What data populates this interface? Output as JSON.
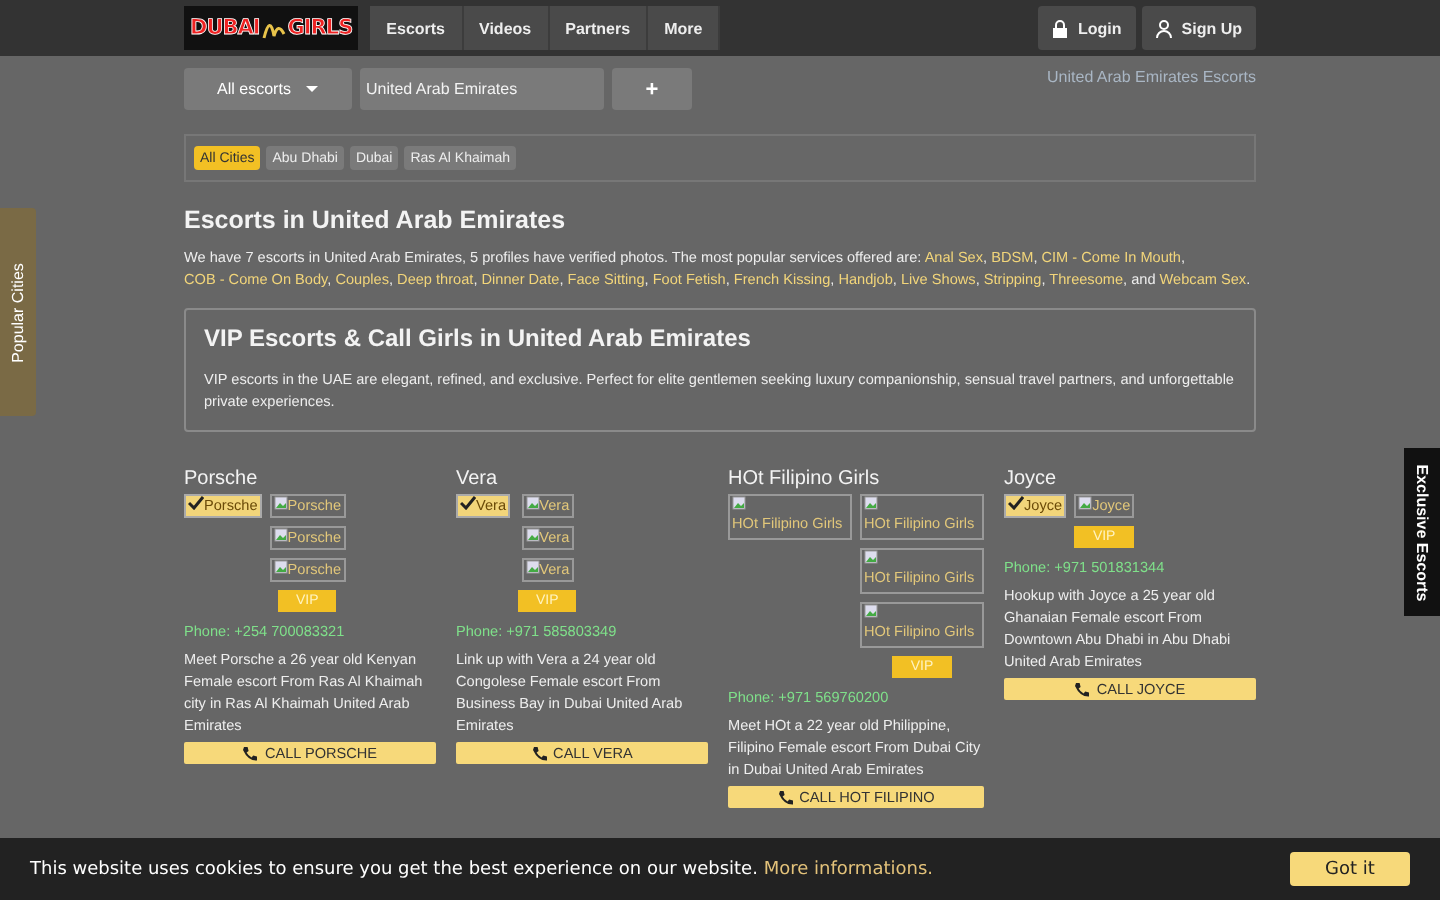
{
  "header": {
    "logo": [
      "DUBAI",
      "GIRLS"
    ],
    "nav": [
      "Escorts",
      "Videos",
      "Partners",
      "More"
    ],
    "login": "Login",
    "signup": "Sign Up"
  },
  "search": {
    "filter": "All escorts",
    "value": "United Arab Emirates",
    "add": "+",
    "faint_link": "United Arab Emirates Escorts"
  },
  "cities": [
    {
      "label": "All Cities",
      "selected": true
    },
    {
      "label": "Abu Dhabi",
      "selected": false
    },
    {
      "label": "Dubai",
      "selected": false
    },
    {
      "label": "Ras Al Khaimah",
      "selected": false
    }
  ],
  "side_tabs": {
    "left": "Popular Cities",
    "right": "Exclusive Escorts"
  },
  "heading": "Escorts in United Arab Emirates",
  "intro": {
    "text": "We have 7 escorts in United Arab Emirates, 5 profiles have verified photos. The most popular services offered are:",
    "links": [
      "Anal Sex",
      "BDSM",
      "CIM - Come In Mouth",
      "COB - Come On Body",
      "Couples",
      "Deep throat",
      "Dinner Date",
      "Face Sitting",
      "Foot Fetish",
      "French Kissing",
      "Handjob",
      "Live Shows",
      "Stripping",
      "Threesome"
    ],
    "last_link": "Webcam Sex",
    "joiner": "and",
    "separator": ",",
    "end": "."
  },
  "vip_box": {
    "title": "VIP Escorts & Call Girls in United Arab Emirates",
    "text": "VIP escorts in the UAE are elegant, refined, and exclusive. Perfect for elite gentlemen seeking luxury companionship, sensual travel partners, and unforgettable private experiences."
  },
  "profiles": [
    {
      "name": "Porsche",
      "images": [
        {
          "alt": "Porsche",
          "kind": "verified"
        },
        {
          "alt": "Porsche",
          "kind": "broken"
        },
        {
          "alt": "Porsche",
          "kind": "broken"
        },
        {
          "alt": "Porsche",
          "kind": "broken"
        }
      ],
      "badge": "VIP",
      "phone": "Phone: +254 700083321",
      "text": "Meet Porsche a 26 year old Kenyan Female escort From Ras Al Khaimah city in Ras Al Khaimah United Arab Emirates",
      "call": "CALL PORSCHE"
    },
    {
      "name": "Vera",
      "images": [
        {
          "alt": "Vera",
          "kind": "verified"
        },
        {
          "alt": "Vera",
          "kind": "broken"
        },
        {
          "alt": "Vera",
          "kind": "broken"
        },
        {
          "alt": "Vera",
          "kind": "broken"
        }
      ],
      "badge": "VIP",
      "phone": "Phone: +971 585803349",
      "text": "Link up with Vera a 24 year old Congolese Female escort From Business Bay in Dubai United Arab Emirates",
      "call": "CALL VERA"
    },
    {
      "name": "HOt Filipino Girls",
      "images": [
        {
          "alt": "HOt Filipino Girls",
          "kind": "broken"
        },
        {
          "alt": "HOt Filipino Girls",
          "kind": "broken"
        },
        {
          "alt": "HOt Filipino Girls",
          "kind": "broken"
        },
        {
          "alt": "HOt Filipino Girls",
          "kind": "broken"
        }
      ],
      "badge": "VIP",
      "phone": "Phone: +971 569760200",
      "text": "Meet HOt a 22 year old Philippine, Filipino Female escort From Dubai City in Dubai United Arab Emirates",
      "call": "CALL HOT FILIPINO"
    },
    {
      "name": "Joyce",
      "images": [
        {
          "alt": "Joyce",
          "kind": "verified"
        },
        {
          "alt": "Joyce",
          "kind": "broken"
        }
      ],
      "badge": "VIP",
      "phone": "Phone: +971 501831344",
      "text": "Hookup with Joyce a 25 year old Ghanaian Female escort From Downtown Abu Dhabi in Abu Dhabi United Arab Emirates",
      "call": "CALL JOYCE"
    }
  ],
  "cookie": {
    "text": "This website uses cookies to ensure you get the best experience on our website.",
    "link": "More informations.",
    "button": "Got it"
  }
}
